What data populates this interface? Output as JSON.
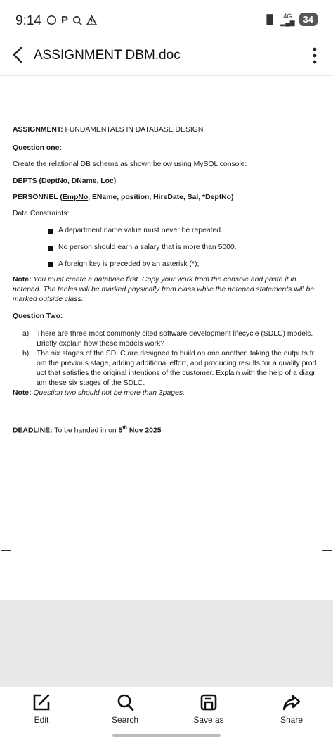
{
  "status": {
    "time": "9:14",
    "notif_icons": [
      "whatsapp-icon",
      "p-icon",
      "search-icon",
      "warning-icon"
    ],
    "network": "4G",
    "battery": "34"
  },
  "app_bar": {
    "title": "ASSIGNMENT DBM.doc"
  },
  "document": {
    "assignment_label": "ASSIGNMENT:",
    "assignment_title": " FUNDAMENTALS IN DATABASE DESIGN",
    "q1_heading": "Question one:",
    "q1_instruction": "Create the relational DB schema as shown below using MySQL console:",
    "depts_prefix": "DEPTS (",
    "depts_key": "DeptNo",
    "depts_rest": ", DName, Loc)",
    "personnel_prefix": "PERSONNEL (",
    "personnel_key": "EmpNo",
    "personnel_rest": ", EName, position, HireDate, Sal, *DeptNo)",
    "constraints_label": "Data Constraints:",
    "constraints": [
      "A department name value must never be repeated.",
      "No person should earn a salary that is more than 5000.",
      "A foreign key is preceded by an asterisk (*);"
    ],
    "note1_label": "Note:",
    "note1_text": " You must create a database first. Copy your work from the console and paste it in notepad. The tables will be marked physically from class while the notepad statements will be marked outside class.",
    "q2_heading": "Question Two:",
    "q2_items": [
      {
        "label": "a)",
        "text": "There are three most commonly cited software development lifecycle (SDLC) models. Briefly explain how these models work?"
      },
      {
        "label": "b)",
        "text": "The six stages of the SDLC are designed to build on one another, taking the outputs from the previous stage, adding additional effort, and producing results for a quality product that satisfies the original intentions of the customer. Explain with the help of a diagram these six stages of the SDLC."
      }
    ],
    "note2_label": "Note:",
    "note2_text": " Question two should not be more than 3pages.",
    "deadline_label": "DEADLINE:",
    "deadline_text": " To be handed in on ",
    "deadline_day": "5",
    "deadline_sup": "th",
    "deadline_date": " Nov 2025"
  },
  "toolbar": {
    "edit_label": "Edit",
    "search_label": "Search",
    "save_label": "Save as",
    "share_label": "Share"
  }
}
